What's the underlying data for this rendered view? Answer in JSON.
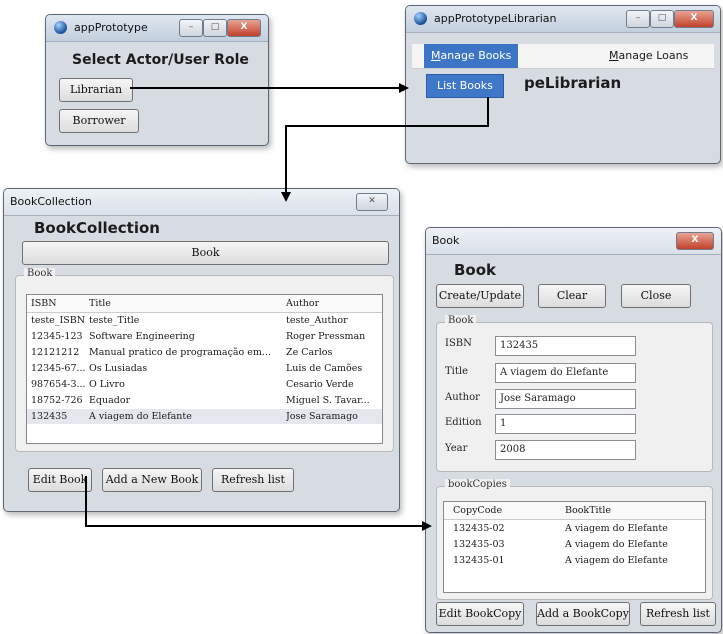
{
  "role_window": {
    "title": "appPrototype",
    "heading": "Select Actor/User Role",
    "buttons": {
      "librarian": "Librarian",
      "borrower": "Borrower"
    }
  },
  "librarian_window": {
    "title": "appPrototypeLibrarian",
    "menus": {
      "manage_books_underline": "M",
      "manage_books_rest": "anage Books",
      "manage_loans_underline": "M",
      "manage_loans_rest": "anage Loans"
    },
    "dropdown_item": "List Books",
    "heading": "appPrototypeLibrarian",
    "heading_visible_tail": "peLibrarian"
  },
  "bookcollection_window": {
    "title": "BookCollection",
    "heading": "BookCollection",
    "top_button": "Book",
    "group_label": "Book",
    "columns": [
      "ISBN",
      "Title",
      "Author"
    ],
    "rows": [
      [
        "teste_ISBN",
        "teste_Title",
        "teste_Author"
      ],
      [
        "12345-123",
        "Software Engineering",
        "Roger Pressman"
      ],
      [
        "12121212",
        "Manual pratico de programação em...",
        "Ze Carlos"
      ],
      [
        "12345-67...",
        "Os Lusiadas",
        "Luis de Camões"
      ],
      [
        "987654-3...",
        "O Livro",
        "Cesario Verde"
      ],
      [
        "18752-726",
        "Equador",
        "Miguel S. Tavar..."
      ],
      [
        "132435",
        "A viagem do Elefante",
        "Jose Saramago"
      ]
    ],
    "buttons": {
      "edit": "Edit Book",
      "add": "Add a New Book",
      "refresh": "Refresh list"
    }
  },
  "book_window": {
    "title": "Book",
    "heading": "Book",
    "buttons": {
      "create_update": "Create/Update",
      "clear": "Clear",
      "close": "Close"
    },
    "group_label": "Book",
    "fields": {
      "isbn": {
        "label": "ISBN",
        "value": "132435"
      },
      "title": {
        "label": "Title",
        "value": "A viagem do Elefante"
      },
      "author": {
        "label": "Author",
        "value": "Jose Saramago"
      },
      "edition": {
        "label": "Edition",
        "value": "1"
      },
      "year": {
        "label": "Year",
        "value": "2008"
      }
    },
    "copies_label": "bookCopies",
    "copies_columns": [
      "CopyCode",
      "BookTitle"
    ],
    "copies_rows": [
      [
        "132435-02",
        "A viagem do Elefante"
      ],
      [
        "132435-03",
        "A viagem do Elefante"
      ],
      [
        "132435-01",
        "A viagem do Elefante"
      ]
    ],
    "bottom_buttons": {
      "edit": "Edit BookCopy",
      "add": "Add a BookCopy",
      "refresh": "Refresh list"
    }
  },
  "colors": {
    "arrow": "#000000",
    "menu_highlight": "#3d75c6",
    "close_button": "#c2412a"
  }
}
